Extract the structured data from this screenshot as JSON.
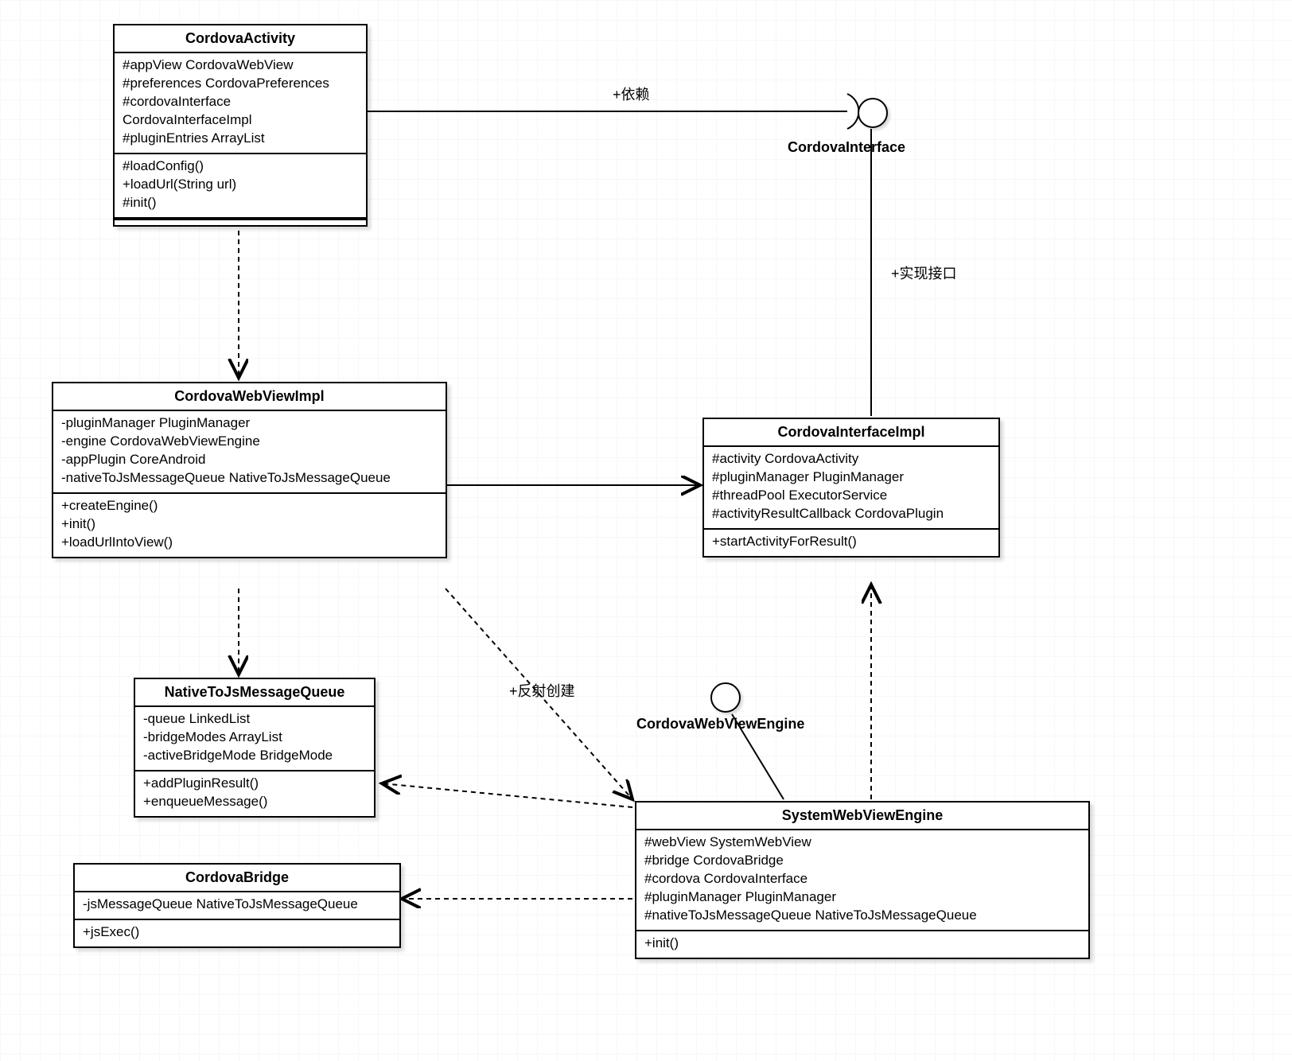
{
  "classes": {
    "CordovaActivity": {
      "name": "CordovaActivity",
      "attrs": [
        "#appView  CordovaWebView",
        "#preferences CordovaPreferences",
        "#cordovaInterface CordovaInterfaceImpl",
        "#pluginEntries ArrayList"
      ],
      "ops": [
        "#loadConfig()",
        "+loadUrl(String url)",
        "#init()"
      ]
    },
    "CordovaWebViewImpl": {
      "name": "CordovaWebViewImpl",
      "attrs": [
        "-pluginManager PluginManager",
        "-engine CordovaWebViewEngine",
        "-appPlugin CoreAndroid",
        "-nativeToJsMessageQueue NativeToJsMessageQueue"
      ],
      "ops": [
        "+createEngine()",
        "+init()",
        "+loadUrlIntoView()"
      ]
    },
    "NativeToJsMessageQueue": {
      "name": "NativeToJsMessageQueue",
      "attrs": [
        "-queue LinkedList",
        "-bridgeModes ArrayList",
        "-activeBridgeMode BridgeMode"
      ],
      "ops": [
        "+addPluginResult()",
        "+enqueueMessage()"
      ]
    },
    "CordovaBridge": {
      "name": "CordovaBridge",
      "attrs": [
        "-jsMessageQueue NativeToJsMessageQueue"
      ],
      "ops": [
        "+jsExec()"
      ]
    },
    "CordovaInterfaceImpl": {
      "name": "CordovaInterfaceImpl",
      "attrs": [
        "#activity CordovaActivity",
        "#pluginManager PluginManager",
        "#threadPool ExecutorService",
        "#activityResultCallback CordovaPlugin"
      ],
      "ops": [
        "+startActivityForResult()"
      ]
    },
    "SystemWebViewEngine": {
      "name": "SystemWebViewEngine",
      "attrs": [
        "#webView SystemWebView",
        "#bridge CordovaBridge",
        "#cordova CordovaInterface",
        "#pluginManager PluginManager",
        "#nativeToJsMessageQueue NativeToJsMessageQueue"
      ],
      "ops": [
        "+init()"
      ]
    }
  },
  "interfaces": {
    "CordovaInterface": "CordovaInterface",
    "CordovaWebViewEngine": "CordovaWebViewEngine"
  },
  "labels": {
    "depends": "+依赖",
    "realize": "+实现接口",
    "reflectCreate": "+反射创建"
  }
}
